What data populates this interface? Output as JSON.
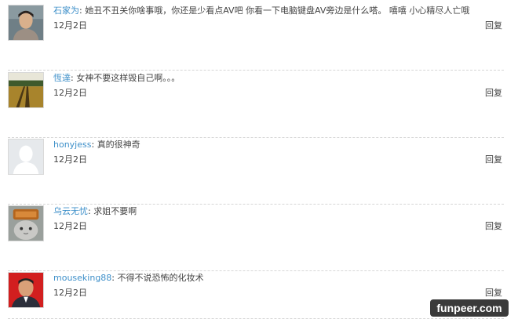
{
  "comments": [
    {
      "username": "石家为",
      "separator": ":",
      "text": "她丑不丑关你啥事哦，你还是少看点AV吧 你看一下电脑键盘AV旁边是什么嗒。 嘻嘻 小心精尽人亡哦",
      "date": "12月2日",
      "reply_label": "回复",
      "avatar_icon": "portrait-photo-icon"
    },
    {
      "username": "恆達",
      "separator": ":",
      "text": "女神不要这样毁自己啊。。。",
      "date": "12月2日",
      "reply_label": "回复",
      "avatar_icon": "field-landscape-icon"
    },
    {
      "username": "honyjess",
      "separator": ":",
      "text": "真的很神奇",
      "date": "12月2日",
      "reply_label": "回复",
      "avatar_icon": "default-user-icon"
    },
    {
      "username": "乌云无忧",
      "separator": ":",
      "text": "求姐不要啊",
      "date": "12月2日",
      "reply_label": "回复",
      "avatar_icon": "cat-with-toast-icon"
    },
    {
      "username": "mouseking88",
      "separator": ":",
      "text": "不得不说恐怖的化妆术",
      "date": "12月2日",
      "reply_label": "回复",
      "avatar_icon": "man-portrait-red-bg-icon"
    }
  ],
  "watermark": "funpeer.com"
}
